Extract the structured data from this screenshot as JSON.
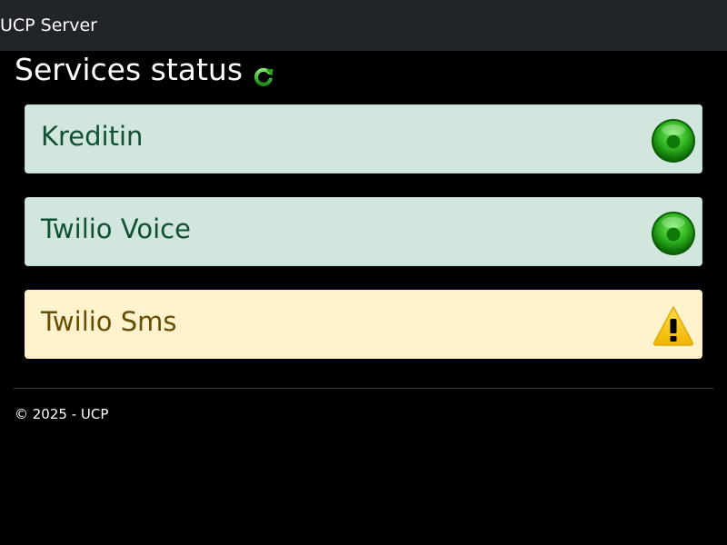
{
  "navbar": {
    "brand": "UCP Server",
    "background": "#212529"
  },
  "page": {
    "title": "Services status",
    "refresh_icon": "refresh-icon"
  },
  "services": [
    {
      "name": "Kreditin",
      "status": "ok",
      "status_icon": "green-status-light-icon",
      "background": "#d1e7dd"
    },
    {
      "name": "Twilio Voice",
      "status": "ok",
      "status_icon": "green-status-light-icon",
      "background": "#d1e7dd"
    },
    {
      "name": "Twilio Sms",
      "status": "warning",
      "status_icon": "warning-triangle-icon",
      "background": "#fff3cd"
    }
  ],
  "footer": {
    "copyright": "© 2025 - UCP"
  }
}
